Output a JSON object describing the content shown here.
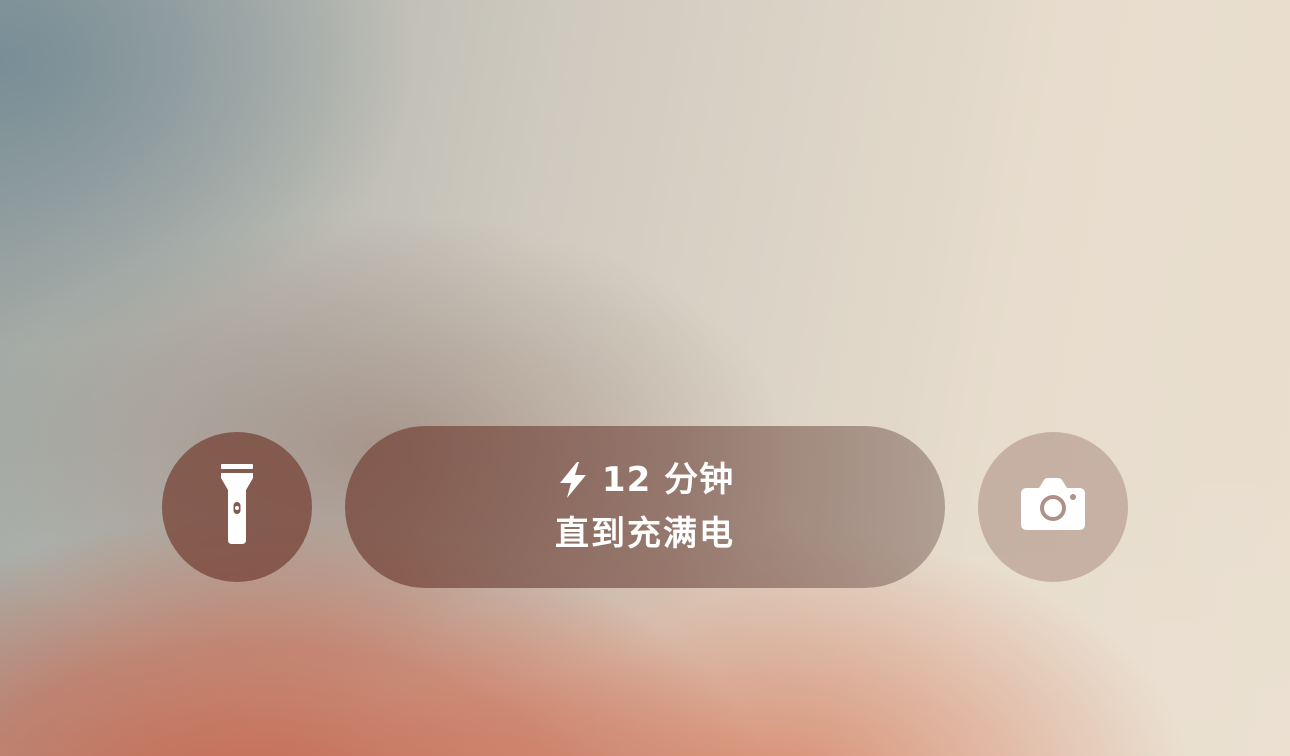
{
  "charging": {
    "time_remaining": "12 分钟",
    "status_text": "直到充满电",
    "icon": "lightning-bolt-icon"
  },
  "quick_actions": {
    "left": {
      "icon": "flashlight-icon"
    },
    "right": {
      "icon": "camera-icon"
    }
  },
  "colors": {
    "wallpaper_top_left": "#7f939a",
    "wallpaper_top_right": "#eadfcf",
    "wallpaper_bottom_left": "#c4563a",
    "button_dark": "#7a463a",
    "button_light": "#b8a198",
    "text": "#ffffff"
  }
}
